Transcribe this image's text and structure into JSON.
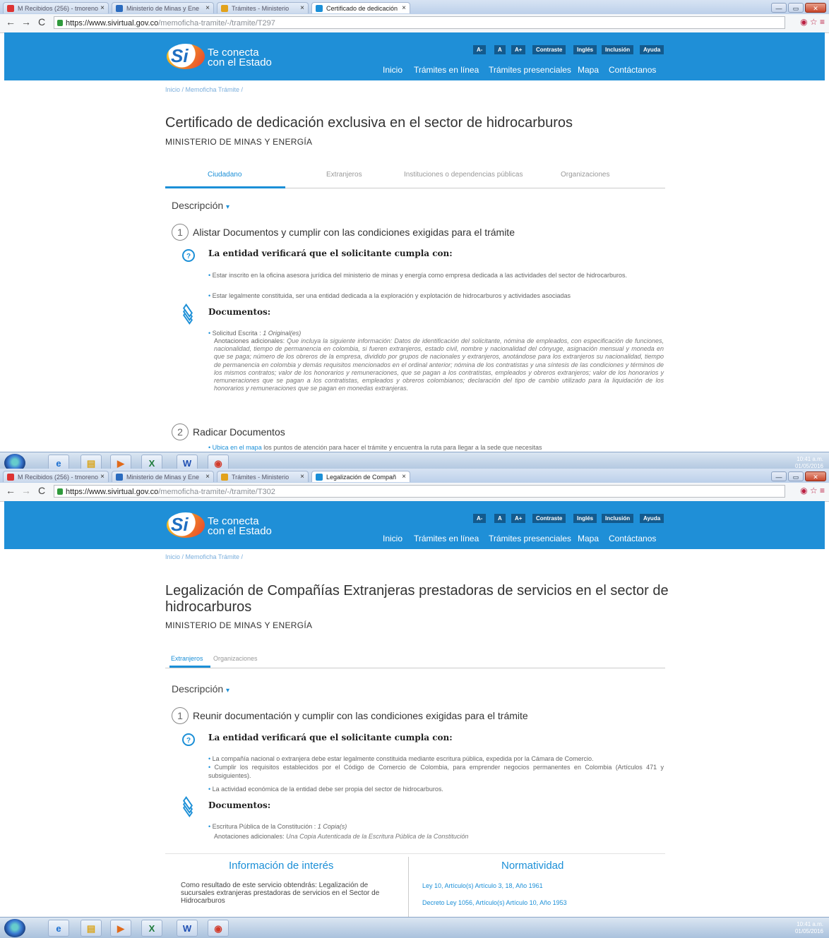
{
  "shots": [
    {
      "tabs": [
        "M Recibidos (256) - tmoreno",
        "Ministerio de Minas y Ene",
        "Trámites - Ministerio",
        "Certificado de dedicación"
      ],
      "url_host": "https://www.sivirtual.gov.co",
      "url_path": "/memoficha-tramite/-/tramite/T297",
      "title": "Certificado de dedicación exclusiva en el sector de hidrocarburos",
      "tabs_page": [
        "Ciudadano",
        "Extranjeros",
        "Instituciones o dependencias públicas",
        "Organizaciones"
      ],
      "step1": "Alistar Documentos y cumplir con las condiciones exigidas para el trámite",
      "conditions": [
        "Estar inscrito en la oficina asesora jurídica del ministerio de minas y energía como empresa dedicada a las actividades del sector de hidrocarburos.",
        "Estar legalmente constituida, ser una entidad dedicada a la exploración y explotación de hidrocarburos y actividades asociadas"
      ],
      "doc_item": "Solicitud Escrita : ",
      "doc_qty": "1 Original(es)",
      "annot_label": "Anotaciones adicionales: ",
      "annot_text": "Que incluya la siguiente información: Datos de identificación del solicitante, nómina de empleados, con especificación de funciones, nacionalidad, tiempo de permanencia en colombia, si fueren extranjeros, estado civil, nombre y nacionalidad del cónyuge, asignación mensual y moneda en que se paga; número de los obreros de la empresa, dividido por grupos de nacionales y extranjeros, anotándose para los extranjeros su nacionalidad, tiempo de permanencia en colombia y demás requisitos mencionados en el ordinal anterior; nómina de los contratistas y una síntesis de las condiciones y términos de los mismos contratos; valor de los honorarios y remuneraciones, que se pagan a los contratistas, empleados y obreros extranjeros; valor de los honorarios y remuneraciones que se pagan a los contratistas, empleados y obreros colombianos; declaración del tipo de cambio utilizado para la liquidación de los honorarios y remuneraciones que se pagan en monedas extranjeras.",
      "step2": "Radicar Documentos",
      "step2_link": "Ubica en el mapa",
      "step2_text": " los puntos de atención para hacer el trámite y encuentra la ruta para llegar a la sede que necesitas",
      "clock_time": "10:41 a.m.",
      "clock_date": "01/05/2016"
    },
    {
      "tabs": [
        "M Recibidos (256) - tmoreno",
        "Ministerio de Minas y Ene",
        "Trámites - Ministerio",
        "Legalización de Compañ"
      ],
      "url_host": "https://www.sivirtual.gov.co",
      "url_path": "/memoficha-tramite/-/tramite/T302",
      "title": "Legalización de Compañías Extranjeras prestadoras de servicios en el sector de hidrocarburos",
      "tabs_page": [
        "Extranjeros",
        "Organizaciones"
      ],
      "step1": "Reunir documentación y cumplir con las condiciones exigidas para el trámite",
      "conditions": [
        "La compañía nacional o extranjera debe estar legalmente constituida mediante escritura pública, expedida por la Cámara de Comercio.",
        "Cumplir los requisitos establecidos por el Código de Comercio de Colombia, para emprender negocios permanentes en Colombia (Artículos 471 y subsiguientes).",
        "La actividad económica de la entidad debe ser propia del sector de hidrocarburos."
      ],
      "doc_item": "Escritura Pública de la Constitución : ",
      "doc_qty": "1 Copia(s)",
      "annot_label": "Anotaciones adicionales: ",
      "annot_text": "Una Copia Autenticada de la Escritura Pública de la Constitución",
      "info_title": "Información de interés",
      "info_text": "Como resultado de este servicio obtendrás: Legalización de sucursales extranjeras prestadoras de servicios en el Sector de Hidrocarburos",
      "norm_title": "Normatividad",
      "norms": [
        "Ley 10, Artículo(s) Artículo 3, 18, Año 1961",
        "Decreto Ley 1056, Artículo(s) Artículo 10, Año 1953"
      ],
      "clock_time": "10:41 a.m.",
      "clock_date": "01/05/2016"
    }
  ],
  "site": {
    "brand": "Si",
    "tagline1": "Te conecta",
    "tagline2": "con el Estado",
    "accessibility": [
      "A-",
      "A",
      "A+",
      "Contraste",
      "Inglés",
      "Inclusión",
      "Ayuda"
    ],
    "nav": [
      "Inicio",
      "Trámites en línea",
      "Trámites presenciales",
      "Mapa",
      "Contáctanos"
    ],
    "breadcrumb": "Inicio / Memoficha Trámite /",
    "ministry": "MINISTERIO DE MINAS Y ENERGÍA",
    "descripcion": "Descripción",
    "verify_head": "La entidad verificará que el solicitante cumpla con:",
    "docs_head": "Documentos:"
  },
  "colors": {
    "header_blue": "#1f8fd7",
    "accent": "#1b8fd7"
  }
}
